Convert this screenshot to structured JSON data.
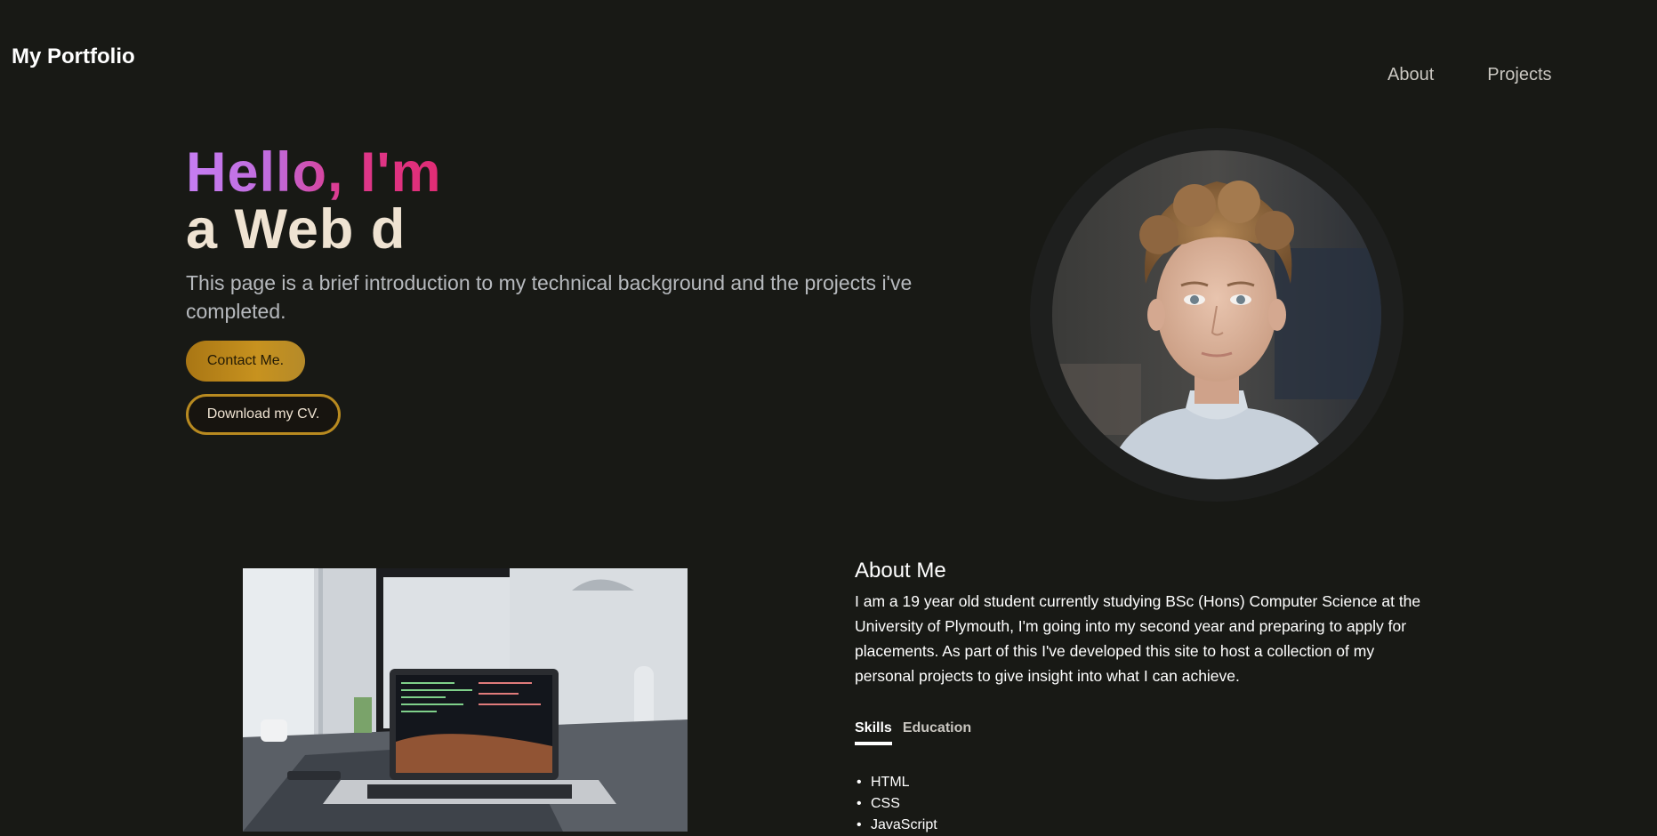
{
  "header": {
    "logo": "My Portfolio",
    "nav": [
      "About",
      "Projects"
    ]
  },
  "hero": {
    "greeting": "Hello, I'm",
    "role": "a Web d",
    "intro": "This page is a brief introduction to my technical background and the projects i've completed.",
    "contact_label": "Contact Me.",
    "cv_label": "Download my CV."
  },
  "about": {
    "title": "About Me",
    "body": "I am a 19 year old student currently studying BSc (Hons) Computer Science at the University of Plymouth, I'm going into my second year and preparing to apply for placements. As part of this I've developed this site to host a collection of my personal projects to give insight into what I can achieve.",
    "tabs": [
      "Skills",
      "Education"
    ],
    "active_tab": "Skills",
    "skills": [
      "HTML",
      "CSS",
      "JavaScript"
    ]
  },
  "colors": {
    "background": "#181915",
    "accent_gold": "#c7921f",
    "gradient_pink": "#e02c74",
    "gradient_violet": "#c67ef4"
  }
}
